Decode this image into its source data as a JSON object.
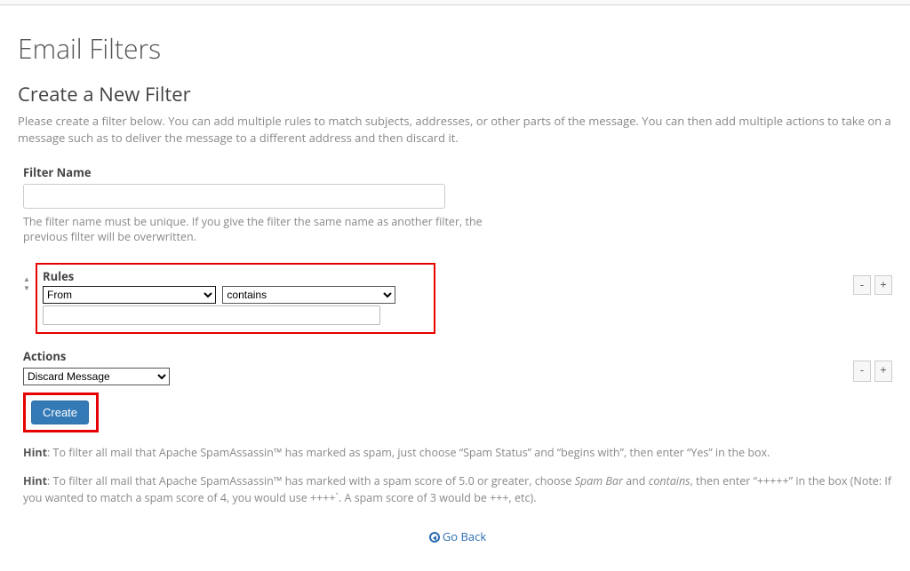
{
  "page": {
    "title": "Email Filters",
    "subtitle": "Create a New Filter",
    "intro": "Please create a filter below. You can add multiple rules to match subjects, addresses, or other parts of the message. You can then add multiple actions to take on a message such as to deliver the message to a different address and then discard it."
  },
  "filterName": {
    "label": "Filter Name",
    "value": "",
    "help": "The filter name must be unique. If you give the filter the same name as another filter, the previous filter will be overwritten."
  },
  "rules": {
    "label": "Rules",
    "part_selected": "From",
    "match_selected": "contains",
    "value": ""
  },
  "actions": {
    "label": "Actions",
    "selected": "Discard Message"
  },
  "buttons": {
    "create": "Create",
    "minus": "-",
    "plus": "+",
    "goback": "Go Back"
  },
  "hints": {
    "h1_prefix": "Hint",
    "h1_text": ": To filter all mail that Apache SpamAssassin™ has marked as spam, just choose “Spam Status” and “begins with”, then enter “Yes” in the box.",
    "h2_prefix": "Hint",
    "h2_before_spambar": ": To filter all mail that Apache SpamAssassin™ has marked with a spam score of 5.0 or greater, choose ",
    "h2_spambar": "Spam Bar",
    "h2_between": " and ",
    "h2_contains": "contains",
    "h2_after": ", then enter “+++++” in the box (Note: If you wanted to match a spam score of 4, you would use ++++`. A spam score of 3 would be +++, etc)."
  }
}
